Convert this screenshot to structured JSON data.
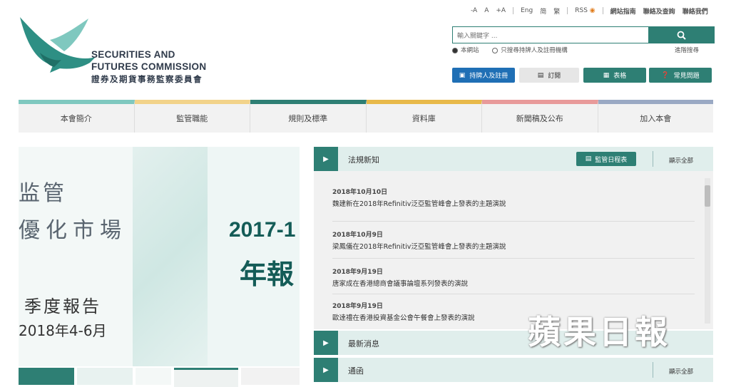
{
  "header": {
    "logo_en_line1": "SECURITIES AND",
    "logo_en_line2": "FUTURES COMMISSION",
    "logo_zh": "證券及期貨事務監察委員會",
    "top_links": [
      "-A",
      "A",
      "+A",
      "Eng",
      "简",
      "繁",
      "RSS",
      "網站指南",
      "聯絡及查詢",
      "聯絡我們"
    ],
    "search_placeholder": "輸入關鍵字 ...",
    "radio_site": "本網站",
    "radio_registry": "只搜尋持牌人及註冊機構",
    "advanced_search": "進階搜尋",
    "buttons": [
      "持牌人及註冊",
      "訂閱",
      "表格",
      "常見問題"
    ]
  },
  "nav": {
    "items": [
      {
        "label": "本會簡介",
        "color": "#7fc8bf"
      },
      {
        "label": "監管職能",
        "color": "#f2d38a"
      },
      {
        "label": "規則及標準",
        "color": "#2e7f74"
      },
      {
        "label": "資料庫",
        "color": "#e8b94a"
      },
      {
        "label": "新聞稿及公布",
        "color": "#e89a9a"
      },
      {
        "label": "加入本會",
        "color": "#9aa9c4"
      }
    ]
  },
  "banner": {
    "line1": "监管",
    "line2": "優化市場",
    "year": "2017-1",
    "annual": "年報",
    "quarterly": "季度報告",
    "date_range": "2018年4-6月"
  },
  "panel": {
    "section1_title": "法規新知",
    "daily_button": "監管日程表",
    "show_all": "顯示全部",
    "news": [
      {
        "date": "2018年10月10日",
        "text": "魏建新在2018年Refinitiv泛亞監管峰會上發表的主題演說"
      },
      {
        "date": "2018年10月9日",
        "text": "梁鳳儀在2018年Refinitiv泛亞監管峰會上發表的主題演說"
      },
      {
        "date": "2018年9月19日",
        "text": "唐家成在香港總商會議事論壇系列發表的演說"
      },
      {
        "date": "2018年9月19日",
        "text": "歐達禮在香港投資基金公會午餐會上發表的演說"
      }
    ],
    "section2_title": "最新消息",
    "section3_title": "通函",
    "show_all_3": "顯示全部"
  },
  "watermark": "蘋果日報",
  "colors": {
    "accent": "#2e7f74",
    "accent_blue": "#1f6fb5"
  }
}
